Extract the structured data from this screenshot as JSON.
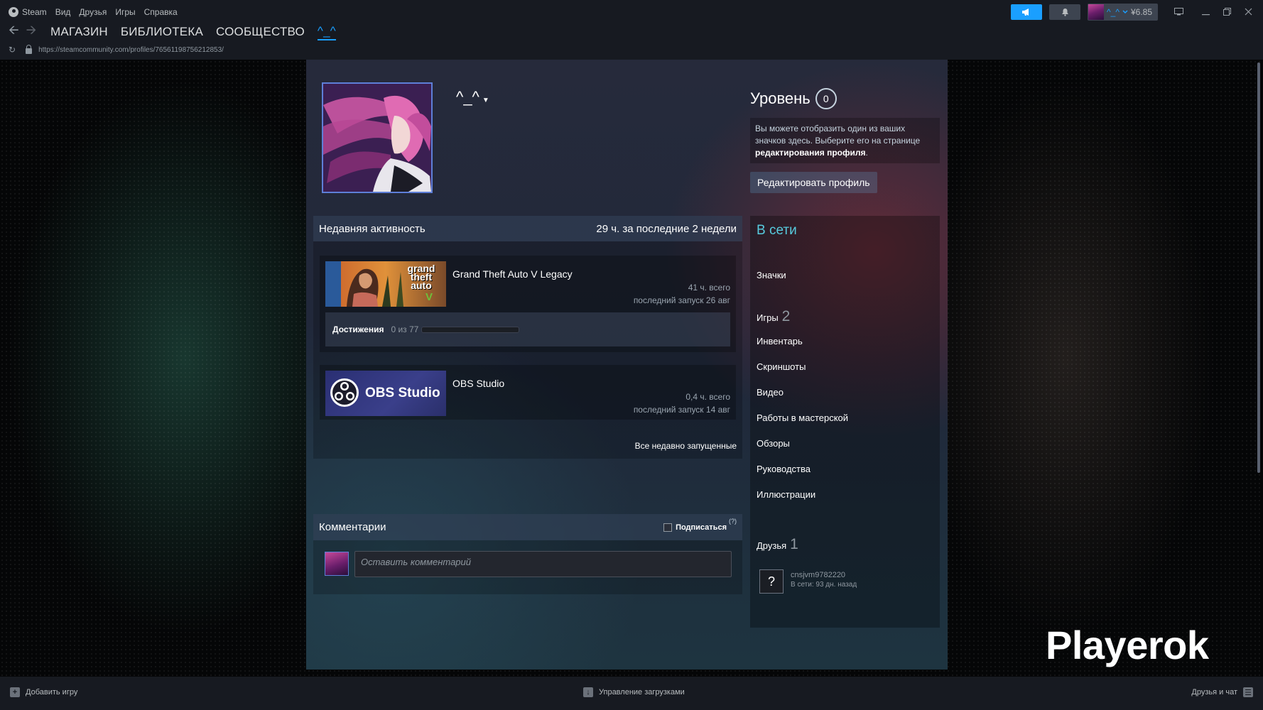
{
  "titlebar": {
    "app_name": "Steam",
    "menu": [
      "Вид",
      "Друзья",
      "Игры",
      "Справка"
    ],
    "account_name": "^_^",
    "balance": "¥6.85"
  },
  "nav": {
    "links": [
      "МАГАЗИН",
      "БИБЛИОТЕКА",
      "СООБЩЕСТВО",
      "^_^"
    ],
    "url": "https://steamcommunity.com/profiles/76561198756212853/"
  },
  "profile": {
    "persona_name": "^_^",
    "level_label": "Уровень",
    "level": "0",
    "badge_text": "Вы можете отобразить один из ваших значков здесь. Выберите его на странице",
    "badge_link": "редактирования профиля",
    "badge_end": ".",
    "edit_button": "Редактировать профиль"
  },
  "recent": {
    "title": "Недавняя активность",
    "hours": "29 ч. за последние 2 недели",
    "games": [
      {
        "name": "Grand Theft Auto V Legacy",
        "hours": "41 ч. всего",
        "last": "последний запуск 26 авг",
        "achievements_label": "Достижения",
        "achievements_count": "0 из 77",
        "achievements_progress": 0
      },
      {
        "name": "OBS Studio",
        "hours": "0,4 ч. всего",
        "last": "последний запуск 14 авг"
      }
    ],
    "capsules": {
      "gta_logo": [
        "grand",
        "theft",
        "auto",
        "V"
      ],
      "obs_logo": "OBS Studio"
    },
    "all_link": "Все недавно запущенные"
  },
  "comments": {
    "title": "Комментарии",
    "subscribe": "Подписаться",
    "help": "(?)",
    "placeholder": "Оставить комментарий"
  },
  "sidebar": {
    "status": "В сети",
    "badges": "Значки",
    "games": "Игры",
    "games_count": "2",
    "inventory": "Инвентарь",
    "screenshots": "Скриншоты",
    "videos": "Видео",
    "workshop": "Работы в мастерской",
    "reviews": "Обзоры",
    "guides": "Руководства",
    "artwork": "Иллюстрации",
    "friends": "Друзья",
    "friends_count": "1",
    "friend": {
      "name": "cnsjvm9782220",
      "status": "В сети: 93 дн. назад",
      "avatar_glyph": "?"
    }
  },
  "watermark": "Playerok",
  "footer": {
    "add_game": "Добавить игру",
    "downloads": "Управление загрузками",
    "friends_chat": "Друзья и чат"
  },
  "colors": {
    "accent": "#1a9fff",
    "online": "#57cbde",
    "chrome": "#171a21"
  }
}
